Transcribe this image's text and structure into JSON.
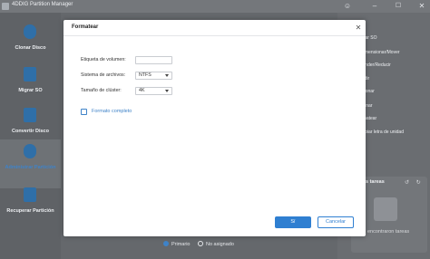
{
  "app": {
    "title": "4DDIG Partition Manager"
  },
  "window_controls": {
    "user": "☺",
    "minimize": "–",
    "maximize": "☐",
    "close": "✕"
  },
  "sidebar": {
    "items": [
      {
        "label": "Clonar Disco",
        "icon": "clone-disk-icon"
      },
      {
        "label": "Migrar SO",
        "icon": "migrate-os-icon"
      },
      {
        "label": "Convertir Disco",
        "icon": "convert-disk-icon"
      },
      {
        "label": "Administrar Partición",
        "icon": "manage-partition-icon",
        "active": true
      },
      {
        "label": "Recuperar Partición",
        "icon": "recover-partition-icon"
      }
    ]
  },
  "right_panel": {
    "menu": [
      "grar SO",
      "dimensionar/Mover",
      "tender/Reducir",
      "vidir",
      "isionar",
      "minar",
      "rmatear",
      "mbiar letra de unidad"
    ],
    "tasks_title": "s tareas",
    "tasks_icons": "↺ ↻",
    "tasks_empty": "encontraron tareas"
  },
  "legend": {
    "primary": "Primario",
    "unassigned": "No asignado"
  },
  "modal": {
    "title": "Formatear",
    "close_icon": "✕",
    "volume_label": "Etiqueta de volumen:",
    "volume_value": "",
    "filesystem_label": "Sistema de archivos:",
    "filesystem_value": "NTFS",
    "cluster_label": "Tamaño de clúster:",
    "cluster_value": "4K",
    "full_format_label": "Formato completo",
    "ok_label": "Sí",
    "cancel_label": "Cancelar"
  },
  "colors": {
    "accent": "#2f7fd1",
    "overlay": "#6b6e72"
  }
}
